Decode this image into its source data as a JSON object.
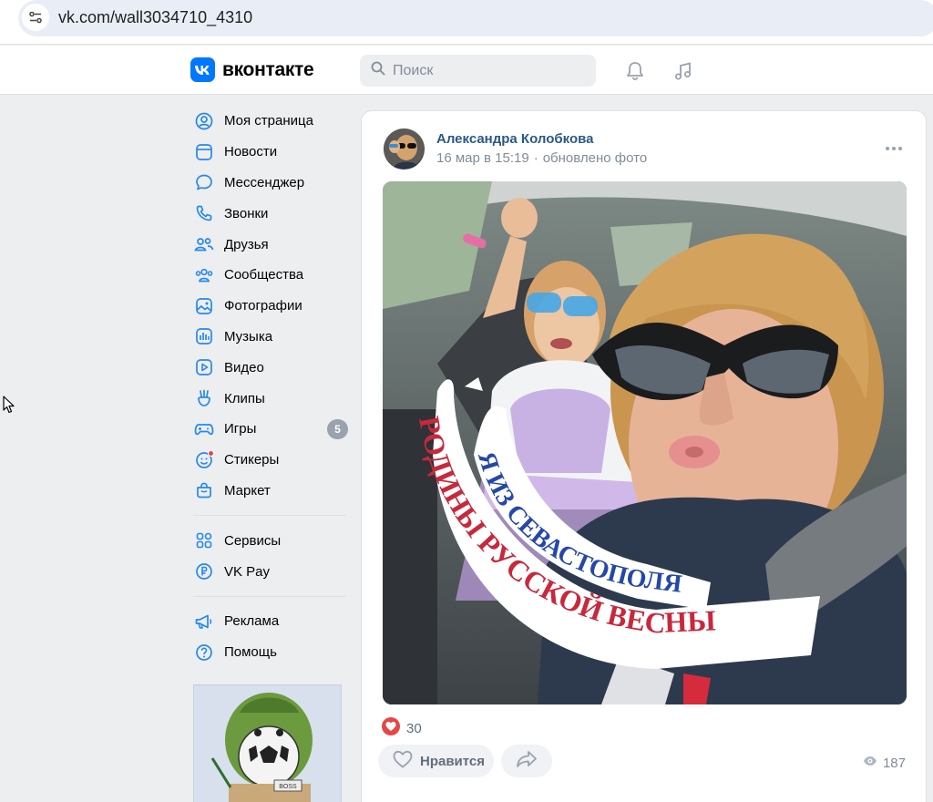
{
  "browser": {
    "url": "vk.com/wall3034710_4310"
  },
  "header": {
    "logo_text": "вконтакте",
    "logo_mark": "VK",
    "search_placeholder": "Поиск",
    "icons": [
      "bell-icon",
      "music-note-icon"
    ]
  },
  "sidebar": {
    "items": [
      {
        "label": "Моя страница",
        "icon": "user-circle-icon"
      },
      {
        "label": "Новости",
        "icon": "news-icon"
      },
      {
        "label": "Мессенджер",
        "icon": "message-icon"
      },
      {
        "label": "Звонки",
        "icon": "phone-icon"
      },
      {
        "label": "Друзья",
        "icon": "friends-icon"
      },
      {
        "label": "Сообщества",
        "icon": "communities-icon"
      },
      {
        "label": "Фотографии",
        "icon": "photos-icon"
      },
      {
        "label": "Музыка",
        "icon": "music-icon"
      },
      {
        "label": "Видео",
        "icon": "video-icon"
      },
      {
        "label": "Клипы",
        "icon": "clips-icon"
      },
      {
        "label": "Игры",
        "icon": "games-icon",
        "badge": "5"
      },
      {
        "label": "Стикеры",
        "icon": "stickers-icon"
      },
      {
        "label": "Маркет",
        "icon": "market-icon"
      }
    ],
    "secondary": [
      {
        "label": "Сервисы",
        "icon": "services-icon"
      },
      {
        "label": "VK Pay",
        "icon": "vkpay-icon"
      }
    ],
    "tertiary": [
      {
        "label": "Реклама",
        "icon": "megaphone-icon"
      },
      {
        "label": "Помощь",
        "icon": "help-icon"
      }
    ],
    "promo_label": "BOSS"
  },
  "post": {
    "author": "Александра Колобкова",
    "date": "16 мар в 15:19",
    "action": "обновлено фото",
    "photo_banner_line1": "Я ИЗ СЕВАСТОПОЛЯ",
    "photo_banner_line2": "РОДИНЫ РУССКОЙ ВЕСНЫ",
    "likes": "30",
    "like_label": "Нравится",
    "views": "187"
  },
  "colors": {
    "accent": "#0077ff",
    "link": "#2a5885",
    "secondary_text": "#818c99",
    "background": "#edeef0",
    "like_red": "#e64646"
  }
}
